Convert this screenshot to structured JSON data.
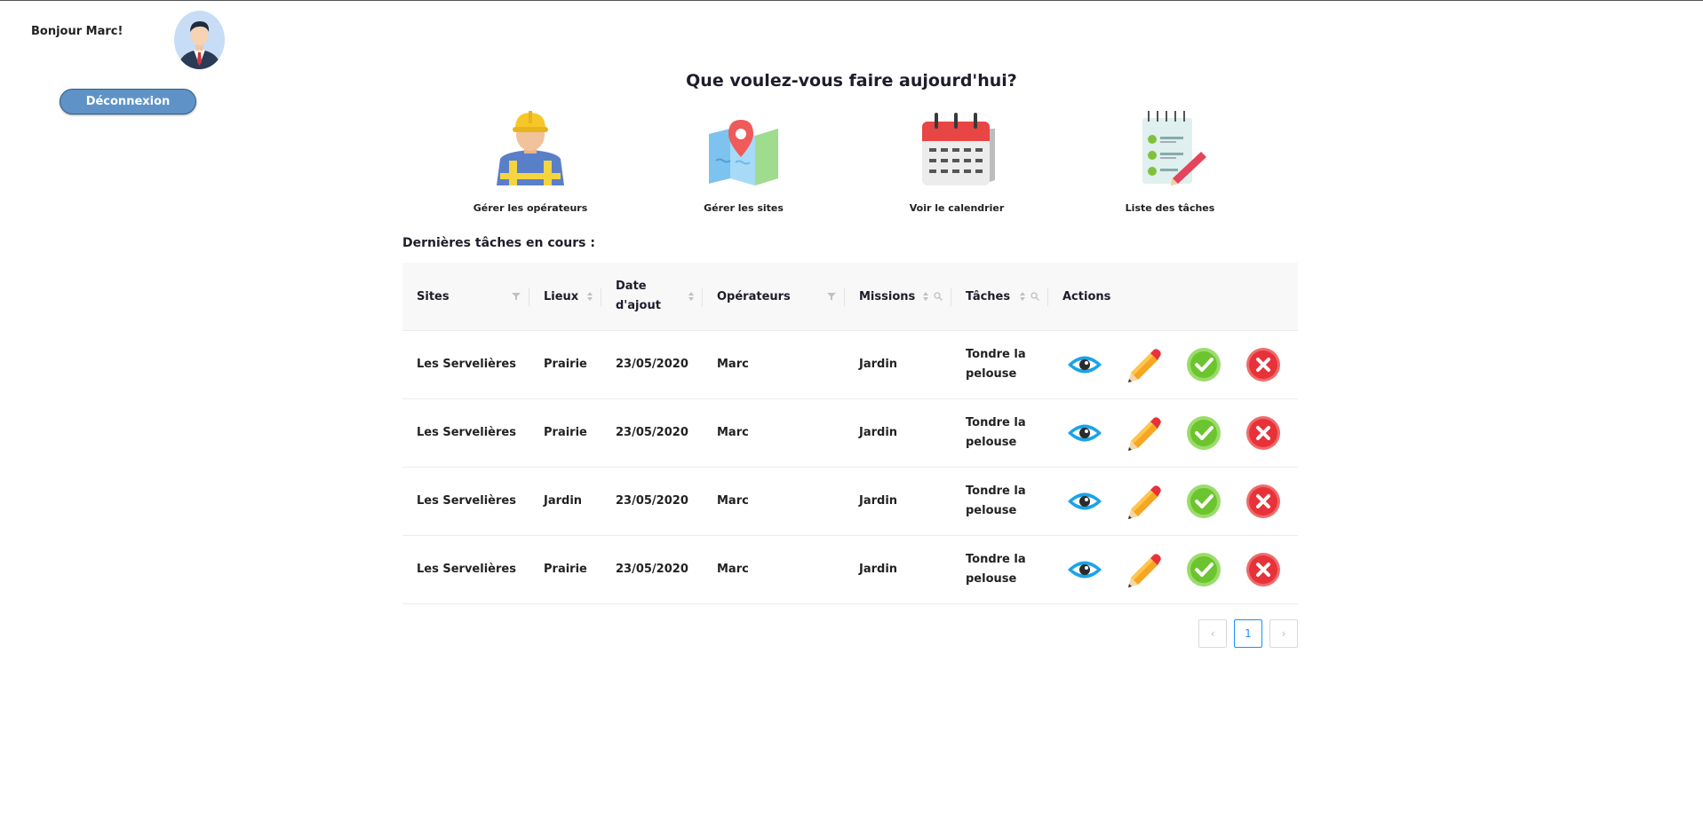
{
  "header": {
    "greeting": "Bonjour Marc!",
    "logout_label": "Déconnexion"
  },
  "main": {
    "title": "Que voulez-vous faire aujourd'hui?",
    "quick_actions": [
      {
        "label": "Gérer les opérateurs",
        "icon": "worker-icon"
      },
      {
        "label": "Gérer les sites",
        "icon": "map-icon"
      },
      {
        "label": "Voir le calendrier",
        "icon": "calendar-icon"
      },
      {
        "label": "Liste des tâches",
        "icon": "checklist-icon"
      }
    ],
    "section_title": "Dernières tâches en cours :"
  },
  "table": {
    "columns": {
      "sites": "Sites",
      "lieux": "Lieux",
      "date_line1": "Date",
      "date_line2": "d'ajout",
      "operateurs": "Opérateurs",
      "missions": "Missions",
      "taches": "Tâches",
      "actions": "Actions"
    },
    "rows": [
      {
        "site": "Les Servelières",
        "lieu": "Prairie",
        "date": "23/05/2020",
        "operateur": "Marc",
        "mission": "Jardin",
        "tache_line1": "Tondre la",
        "tache_line2": "pelouse"
      },
      {
        "site": "Les Servelières",
        "lieu": "Prairie",
        "date": "23/05/2020",
        "operateur": "Marc",
        "mission": "Jardin",
        "tache_line1": "Tondre la",
        "tache_line2": "pelouse"
      },
      {
        "site": "Les Servelières",
        "lieu": "Jardin",
        "date": "23/05/2020",
        "operateur": "Marc",
        "mission": "Jardin",
        "tache_line1": "Tondre la",
        "tache_line2": "pelouse"
      },
      {
        "site": "Les Servelières",
        "lieu": "Prairie",
        "date": "23/05/2020",
        "operateur": "Marc",
        "mission": "Jardin",
        "tache_line1": "Tondre la",
        "tache_line2": "pelouse"
      }
    ],
    "row_actions": [
      "view-icon",
      "edit-icon",
      "validate-icon",
      "delete-icon"
    ]
  },
  "pagination": {
    "current_page": "1",
    "prev_glyph": "‹",
    "next_glyph": "›"
  },
  "colors": {
    "logout_button": "#5f93c7",
    "pagination_active": "#1890ff",
    "view": "#1aa3e8",
    "validate": "#6cc42e",
    "delete": "#e8323a"
  }
}
